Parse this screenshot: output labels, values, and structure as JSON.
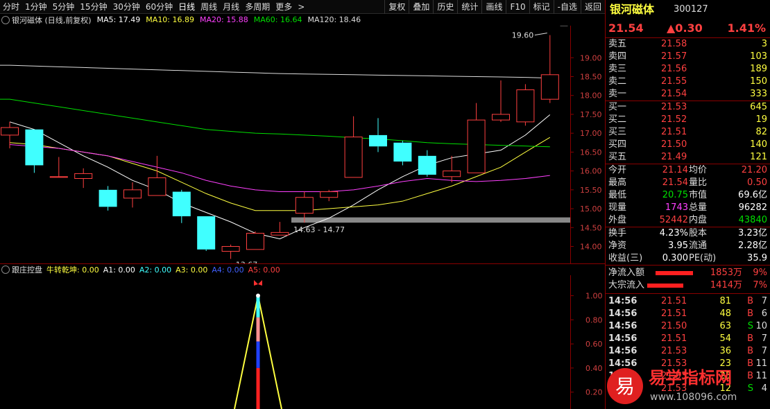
{
  "toolbar": {
    "periods": [
      "分时",
      "1分钟",
      "5分钟",
      "15分钟",
      "30分钟",
      "60分钟",
      "日线",
      "周线",
      "月线",
      "多周期",
      "更多"
    ],
    "active_period": "日线",
    "actions": [
      "复权",
      "叠加",
      "历史",
      "统计",
      "画线",
      "F10",
      "标记",
      "-自选",
      "返回"
    ]
  },
  "infobar": {
    "title": "银河磁体 (日线,前复权)",
    "ma5": "MA5: 17.49",
    "ma10": "MA10: 16.89",
    "ma20": "MA20: 15.88",
    "ma60": "MA60: 16.64",
    "ma120": "MA120: 18.46",
    "colors": {
      "ma5": "#ffffff",
      "ma10": "#ffff40",
      "ma20": "#ff40ff",
      "ma60": "#00e000",
      "ma120": "#dddddd"
    }
  },
  "chart_data": {
    "type": "candlestick",
    "price_axis": [
      "19.00",
      "18.50",
      "18.00",
      "17.50",
      "17.00",
      "16.50",
      "16.00",
      "15.50",
      "15.00",
      "14.50",
      "14.00"
    ],
    "ylim": [
      13.55,
      19.85
    ],
    "candles": [
      {
        "o": 16.95,
        "c": 17.15,
        "h": 17.3,
        "l": 16.6
      },
      {
        "o": 17.1,
        "c": 16.15,
        "h": 17.1,
        "l": 15.95
      },
      {
        "o": 15.83,
        "c": 15.85,
        "h": 16.37,
        "l": 15.83
      },
      {
        "o": 15.8,
        "c": 15.93,
        "h": 16.07,
        "l": 15.55
      },
      {
        "o": 15.5,
        "c": 15.05,
        "h": 15.6,
        "l": 14.95
      },
      {
        "o": 15.28,
        "c": 15.5,
        "h": 15.7,
        "l": 15.03
      },
      {
        "o": 15.35,
        "c": 15.82,
        "h": 16.4,
        "l": 15.35
      },
      {
        "o": 15.45,
        "c": 14.8,
        "h": 15.5,
        "l": 14.62
      },
      {
        "o": 14.8,
        "c": 13.92,
        "h": 14.8,
        "l": 13.88
      },
      {
        "o": 13.87,
        "c": 14.0,
        "h": 14.05,
        "l": 13.67
      },
      {
        "o": 13.92,
        "c": 14.35,
        "h": 14.4,
        "l": 13.92
      },
      {
        "o": 14.3,
        "c": 14.37,
        "h": 14.65,
        "l": 14.3
      },
      {
        "o": 14.88,
        "c": 15.3,
        "h": 15.45,
        "l": 14.63
      },
      {
        "o": 15.3,
        "c": 15.45,
        "h": 15.5,
        "l": 15.2
      },
      {
        "o": 15.83,
        "c": 16.9,
        "h": 17.45,
        "l": 15.83
      },
      {
        "o": 16.95,
        "c": 16.65,
        "h": 17.4,
        "l": 16.5
      },
      {
        "o": 16.75,
        "c": 16.25,
        "h": 16.8,
        "l": 16.15
      },
      {
        "o": 16.4,
        "c": 15.9,
        "h": 16.55,
        "l": 15.85
      },
      {
        "o": 15.85,
        "c": 16.0,
        "h": 16.4,
        "l": 15.7
      },
      {
        "o": 15.95,
        "c": 17.35,
        "h": 17.8,
        "l": 15.95
      },
      {
        "o": 17.35,
        "c": 17.5,
        "h": 18.4,
        "l": 17.3
      },
      {
        "o": 17.3,
        "c": 18.15,
        "h": 18.3,
        "l": 17.2
      },
      {
        "o": 17.9,
        "c": 18.55,
        "h": 19.6,
        "l": 17.8
      }
    ],
    "ma_series": {
      "ma5": [
        17.3,
        17.1,
        16.75,
        16.4,
        16.1,
        15.75,
        15.5,
        15.15,
        14.9,
        14.65,
        14.35,
        14.2,
        14.5,
        14.75,
        15.1,
        15.5,
        15.85,
        16.15,
        16.35,
        16.45,
        16.55,
        16.95,
        17.49
      ],
      "ma10": [
        16.75,
        16.7,
        16.6,
        16.5,
        16.4,
        16.2,
        16.0,
        15.7,
        15.4,
        15.15,
        14.95,
        14.95,
        14.95,
        15.0,
        15.05,
        15.1,
        15.2,
        15.4,
        15.6,
        15.85,
        16.1,
        16.5,
        16.89
      ],
      "ma20": [
        16.7,
        16.65,
        16.6,
        16.5,
        16.4,
        16.25,
        16.1,
        15.95,
        15.75,
        15.6,
        15.5,
        15.45,
        15.45,
        15.45,
        15.5,
        15.6,
        15.72,
        15.8,
        15.75,
        15.72,
        15.75,
        15.8,
        15.88
      ],
      "ma60": [
        17.9,
        17.8,
        17.7,
        17.6,
        17.5,
        17.4,
        17.3,
        17.2,
        17.1,
        17.05,
        17.0,
        16.98,
        16.95,
        16.92,
        16.88,
        16.85,
        16.8,
        16.75,
        16.72,
        16.7,
        16.68,
        16.66,
        16.64
      ],
      "ma120": [
        18.8,
        18.78,
        18.76,
        18.74,
        18.72,
        18.7,
        18.68,
        18.66,
        18.64,
        18.62,
        18.6,
        18.58,
        18.57,
        18.56,
        18.55,
        18.54,
        18.53,
        18.52,
        18.51,
        18.5,
        18.49,
        18.48,
        18.46
      ]
    },
    "annotations": {
      "high": "19.60",
      "low": "←13.67",
      "range": "14.63 - 14.77"
    },
    "zone": [
      14.63,
      14.77
    ]
  },
  "indicator": {
    "name": "跟庄控盘",
    "items": [
      {
        "text": "牛转乾坤: 0.00",
        "color": "#ffff40"
      },
      {
        "text": "A1: 0.00",
        "color": "#ffffff"
      },
      {
        "text": "A2: 0.00",
        "color": "#40ffff"
      },
      {
        "text": "A3: 0.00",
        "color": "#ffff40"
      },
      {
        "text": "A4: 0.00",
        "color": "#4060ff"
      },
      {
        "text": "A5: 0.00",
        "color": "#ff4040"
      }
    ],
    "axis": [
      "1.00",
      "0.80",
      "0.60",
      "0.40",
      "0.20"
    ],
    "ylim": [
      0.06,
      1.17
    ]
  },
  "quote": {
    "name": "银河磁体",
    "code": "300127",
    "price": "21.54",
    "change": "▲0.30",
    "pct": "1.41%",
    "asks": [
      {
        "label": "卖五",
        "price": "21.58",
        "vol": "3"
      },
      {
        "label": "卖四",
        "price": "21.57",
        "vol": "103"
      },
      {
        "label": "卖三",
        "price": "21.56",
        "vol": "189"
      },
      {
        "label": "卖二",
        "price": "21.55",
        "vol": "150"
      },
      {
        "label": "卖一",
        "price": "21.54",
        "vol": "333"
      }
    ],
    "bids": [
      {
        "label": "买一",
        "price": "21.53",
        "vol": "645"
      },
      {
        "label": "买二",
        "price": "21.52",
        "vol": "19"
      },
      {
        "label": "买三",
        "price": "21.51",
        "vol": "82"
      },
      {
        "label": "买四",
        "price": "21.50",
        "vol": "140"
      },
      {
        "label": "买五",
        "price": "21.49",
        "vol": "121"
      }
    ],
    "stats": [
      {
        "l1": "今开",
        "v1": "21.14",
        "c1": "red",
        "l2": "均价",
        "v2": "21.20",
        "c2": "red"
      },
      {
        "l1": "最高",
        "v1": "21.54",
        "c1": "red",
        "l2": "量比",
        "v2": "0.50",
        "c2": "red"
      },
      {
        "l1": "最低",
        "v1": "20.75",
        "c1": "green",
        "l2": "市值",
        "v2": "69.6亿",
        "c2": "white"
      },
      {
        "l1": "现量",
        "v1": "1743",
        "c1": "magenta",
        "l2": "总量",
        "v2": "96282",
        "c2": "white"
      },
      {
        "l1": "外盘",
        "v1": "52442",
        "c1": "red",
        "l2": "内盘",
        "v2": "43840",
        "c2": "green"
      }
    ],
    "stats2": [
      {
        "l1": "换手",
        "v1": "4.23%",
        "l2": "股本",
        "v2": "3.23亿"
      },
      {
        "l1": "净资",
        "v1": "3.95",
        "l2": "流通",
        "v2": "2.28亿"
      },
      {
        "l1": "收益(三)",
        "v1": "0.300",
        "l2": "PE(动)",
        "v2": "35.9"
      }
    ],
    "flows": [
      {
        "label": "净流入额",
        "value": "1853万",
        "pct": "9%"
      },
      {
        "label": "大宗流入",
        "value": "1414万",
        "pct": "7%"
      }
    ],
    "ticks": [
      {
        "time": "14:56",
        "price": "21.51",
        "vol": "81",
        "side": "B",
        "n": "7"
      },
      {
        "time": "14:56",
        "price": "21.51",
        "vol": "48",
        "side": "B",
        "n": "6"
      },
      {
        "time": "14:56",
        "price": "21.50",
        "vol": "63",
        "side": "S",
        "n": "10"
      },
      {
        "time": "14:56",
        "price": "21.51",
        "vol": "54",
        "side": "B",
        "n": "7"
      },
      {
        "time": "14:56",
        "price": "21.53",
        "vol": "36",
        "side": "B",
        "n": "7"
      },
      {
        "time": "14:56",
        "price": "21.53",
        "vol": "23",
        "side": "B",
        "n": "11"
      },
      {
        "time": "14:56",
        "price": "21.53",
        "vol": "25",
        "side": "B",
        "n": "11"
      },
      {
        "time": "14:56",
        "price": "21.53",
        "vol": "12",
        "side": "S",
        "n": "4"
      }
    ]
  },
  "watermark": {
    "badge": "易",
    "title": "易学指标网",
    "url": "www.108096.com"
  }
}
